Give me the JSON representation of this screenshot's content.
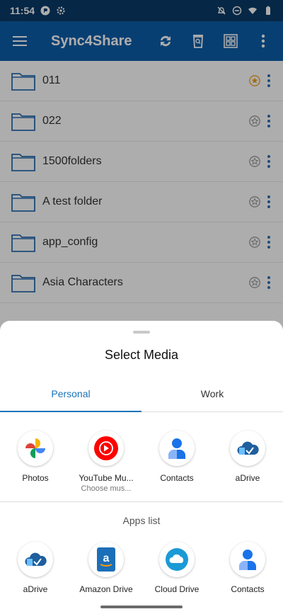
{
  "status_bar": {
    "time": "11:54"
  },
  "app_bar": {
    "title": "Sync4Share"
  },
  "list": {
    "items": [
      {
        "label": "011",
        "starred": true
      },
      {
        "label": "022",
        "starred": false
      },
      {
        "label": "1500folders",
        "starred": false
      },
      {
        "label": "A test folder",
        "starred": false
      },
      {
        "label": "app_config",
        "starred": false
      },
      {
        "label": "Asia Characters",
        "starred": false
      }
    ]
  },
  "sheet": {
    "title": "Select Media",
    "tabs": [
      {
        "label": "Personal",
        "active": true
      },
      {
        "label": "Work",
        "active": false
      }
    ],
    "top_apps": [
      {
        "label": "Photos",
        "icon": "google-photos-icon"
      },
      {
        "label": "YouTube Mu...",
        "sublabel": "Choose mus...",
        "icon": "youtube-music-icon"
      },
      {
        "label": "Contacts",
        "icon": "contacts-icon"
      },
      {
        "label": "aDrive",
        "icon": "adrive-icon"
      }
    ],
    "apps_list_label": "Apps list",
    "apps_list": [
      {
        "label": "aDrive",
        "icon": "adrive-icon"
      },
      {
        "label": "Amazon Drive",
        "icon": "amazon-drive-icon"
      },
      {
        "label": "Cloud Drive",
        "icon": "cloud-drive-icon"
      },
      {
        "label": "Contacts",
        "icon": "contacts-icon"
      }
    ]
  },
  "colors": {
    "app_bar": "#0d5ea8",
    "status_bar": "#0a3a66",
    "accent": "#1a73b8"
  }
}
